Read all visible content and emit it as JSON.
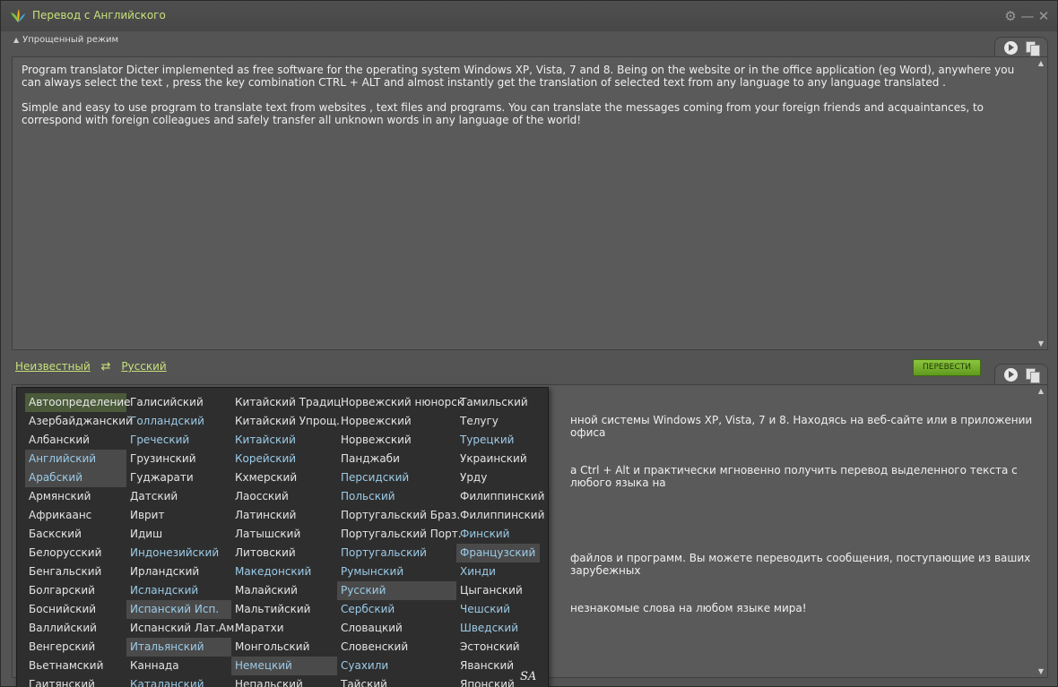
{
  "window": {
    "title": "Перевод с Английского",
    "icons": [
      "app-leaf-icon",
      "gear-icon",
      "minimize-icon",
      "close-icon"
    ]
  },
  "mode": {
    "label": "Упрощенный режим"
  },
  "source": {
    "text": "Program translator Dicter implemented as free software for the operating system Windows XP, Vista, 7 and 8. Being on the website or in the office application (eg Word), anywhere you can always select the text , press the key combination CTRL + ALT and almost instantly get the translation of selected text from any language to any language translated .\n\nSimple and easy to use program to translate text from websites , text files and programs. You can translate the messages coming from your foreign friends and acquaintances, to correspond with foreign colleagues and safely transfer all unknown words in any language of the world!"
  },
  "languages": {
    "from": "Неизвестный",
    "to": "Русский",
    "translate_button": "ПЕРЕВЕСТИ"
  },
  "result": {
    "line1_visible": "нной системы Windows XP, Vista, 7 и 8. Находясь на веб-сайте или в приложении офиса",
    "line2_visible": "а Ctrl + Alt и практически мгновенно получить перевод выделенного текста с любого языка на",
    "line3_visible": "файлов и программ. Вы можете переводить сообщения, поступающие из ваших зарубежных",
    "line4_visible": "незнакомые слова на любом языке мира!"
  },
  "dropdown": {
    "columns": [
      [
        "Автоопределение",
        "Азербайджанский",
        "Албанский",
        "Английский",
        "Арабский",
        "Армянский",
        "Африкаанс",
        "Баскский",
        "Белорусский",
        "Бенгальский",
        "Болгарский",
        "Боснийский",
        "Валлийский",
        "Венгерский",
        "Вьетнамский",
        "Гаитянский"
      ],
      [
        "Галисийский",
        "Голландский",
        "Греческий",
        "Грузинский",
        "Гуджарати",
        "Датский",
        "Иврит",
        "Идиш",
        "Индонезийский",
        "Ирландский",
        "Исландский",
        "Испанский Исп.",
        "Испанский Лат.Ам.",
        "Итальянский",
        "Каннада",
        "Каталанский"
      ],
      [
        "Китайский Традиц.",
        "Китайский Упрощ.",
        "Китайский",
        "Корейский",
        "Кхмерский",
        "Лаосский",
        "Латинский",
        "Латышский",
        "Литовский",
        "Македонский",
        "Малайский",
        "Мальтийский",
        "Маратхи",
        "Монгольский",
        "Немецкий",
        "Непальский"
      ],
      [
        "Норвежский нюнорск",
        "Норвежский",
        "Норвежский",
        "Панджаби",
        "Персидский",
        "Польский",
        "Португальский Браз.",
        "Португальский Порт.",
        "Португальский",
        "Румынский",
        "Русский",
        "Сербский",
        "Словацкий",
        "Словенский",
        "Суахили",
        "Тайский"
      ],
      [
        "Тамильский",
        "Телугу",
        "Турецкий",
        "Украинский",
        "Урду",
        "Филиппинский",
        "Филиппинский",
        "Финский",
        "Французский",
        "Хинди",
        "Цыганский",
        "Чешский",
        "Шведский",
        "Эстонский",
        "Яванский",
        "Японский"
      ]
    ],
    "watermark": "SA"
  }
}
